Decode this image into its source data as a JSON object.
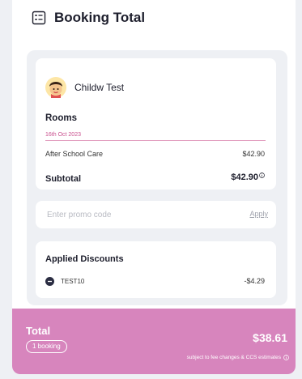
{
  "header": {
    "title": "Booking Total",
    "icon": "receipt-list-icon"
  },
  "child": {
    "name": "Childw Test",
    "avatar_icon": "child-avatar-icon"
  },
  "rooms": {
    "title": "Rooms",
    "date": "16th Oct 2023",
    "items": [
      {
        "label": "After School Care",
        "amount": "$42.90"
      }
    ],
    "subtotal_label": "Subtotal",
    "subtotal_value": "$42.90"
  },
  "promo": {
    "placeholder": "Enter promo code",
    "apply_label": "Apply"
  },
  "discounts": {
    "title": "Applied Discounts",
    "items": [
      {
        "code": "TEST10",
        "amount": "-$4.29"
      }
    ]
  },
  "total": {
    "label": "Total",
    "booking_count": "1 booking",
    "value": "$38.61",
    "note": "subject to fee changes & CCS estimates"
  },
  "colors": {
    "accent": "#d785bd",
    "date_pink": "#c9518f",
    "panel_bg": "#eef0f4"
  }
}
